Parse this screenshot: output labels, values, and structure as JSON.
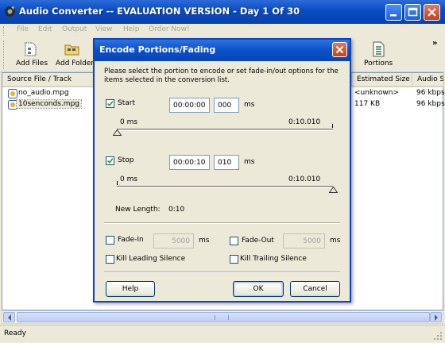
{
  "app": {
    "title": "Audio Converter  -- EVALUATION VERSION - Day 1 Of 30",
    "menu": [
      "File",
      "Edit",
      "Output",
      "View",
      "Help",
      "Order Now!"
    ],
    "toolbar": {
      "add_files": "Add Files",
      "add_folder": "Add Folder",
      "portions": "Portions",
      "overflow": "»"
    },
    "list": {
      "columns": [
        "Source File / Track",
        "Estimated Size",
        "Audio S"
      ],
      "rows": [
        {
          "name": "no_audio.mpg",
          "size": "<unknown>",
          "audio": "96 kbps"
        },
        {
          "name": "10senconds.mpg",
          "size": "117 KB",
          "audio": "96 kbps"
        }
      ]
    },
    "status": "Ready"
  },
  "dialog": {
    "title": "Encode Portions/Fading",
    "description": "Please select the portion to encode or set fade-in/out options for the items selected in the conversion list.",
    "start": {
      "label": "Start",
      "checked": true,
      "time": "00:00:00",
      "ms": "000",
      "unit": "ms",
      "range_min": "0 ms",
      "range_max": "0:10.010",
      "position": 0
    },
    "stop": {
      "label": "Stop",
      "checked": true,
      "time": "00:00:10",
      "ms": "010",
      "unit": "ms",
      "range_min": "0 ms",
      "range_max": "0:10.010",
      "position": 1
    },
    "new_length_label": "New Length:",
    "new_length_value": "0:10",
    "fade_in": {
      "label": "Fade-In",
      "value": "5000",
      "unit": "ms",
      "checked": false
    },
    "fade_out": {
      "label": "Fade-Out",
      "value": "5000",
      "unit": "ms",
      "checked": false
    },
    "kill_leading": {
      "label": "Kill Leading Silence",
      "checked": false
    },
    "kill_trailing": {
      "label": "Kill Trailing Silence",
      "checked": false
    },
    "buttons": {
      "help": "Help",
      "ok": "OK",
      "cancel": "Cancel"
    }
  },
  "colors": {
    "titlebar": "#0a4bc2",
    "face": "#ece9d8",
    "close": "#c4401f"
  }
}
